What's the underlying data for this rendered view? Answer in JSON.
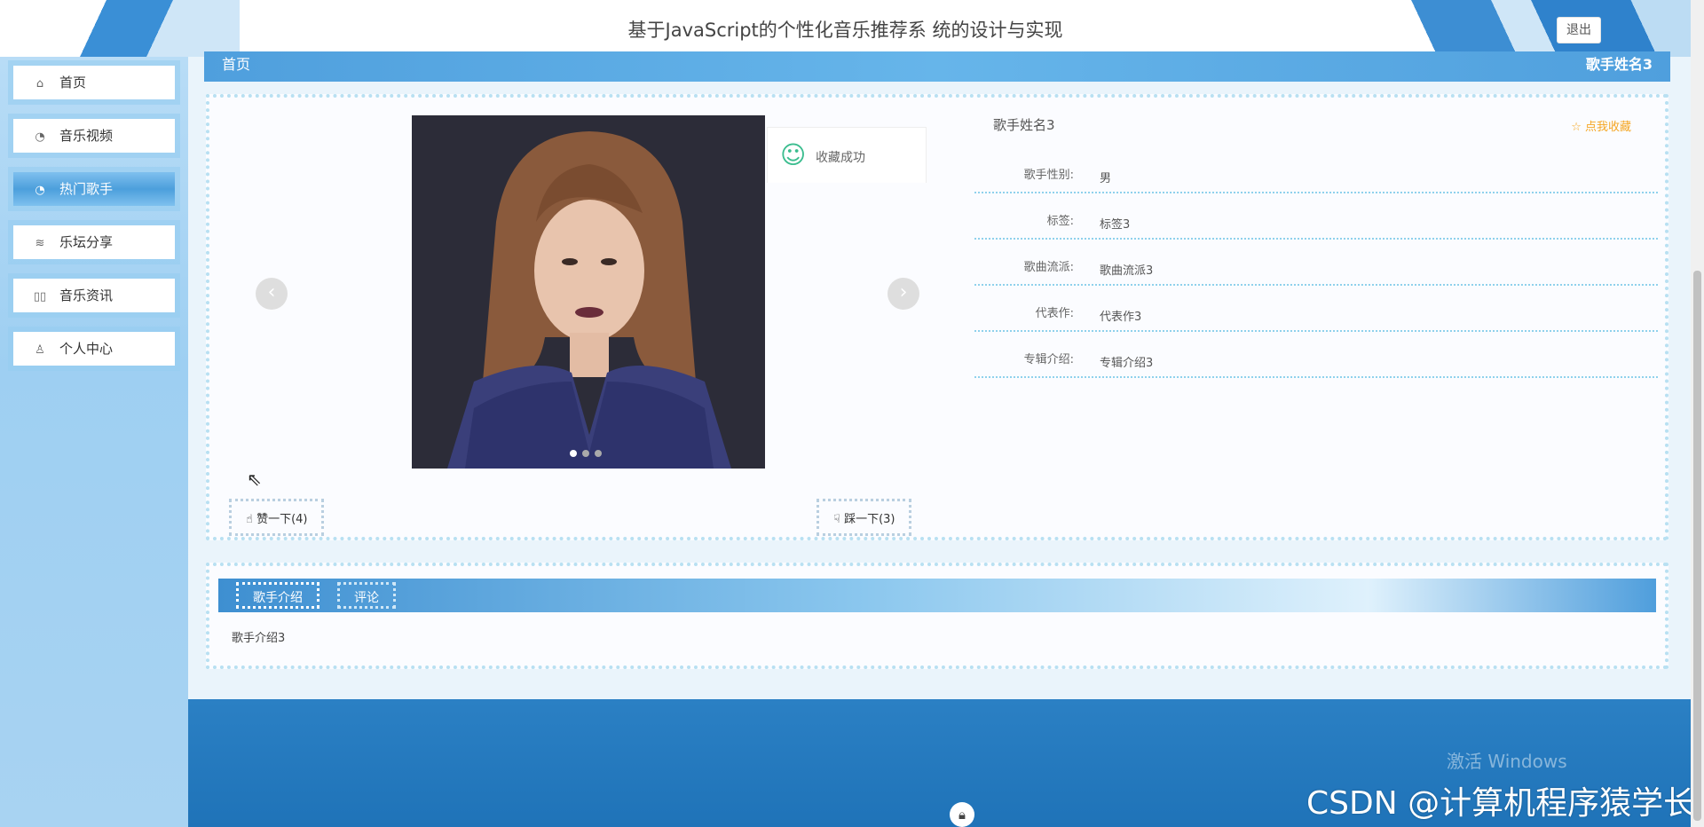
{
  "header": {
    "title": "基于JavaScript的个性化音乐推荐系 统的设计与实现",
    "logout_label": "退出"
  },
  "sidebar": {
    "items": [
      {
        "label": "首页",
        "icon": "home-icon",
        "active": false
      },
      {
        "label": "音乐视频",
        "icon": "palette-icon",
        "active": false
      },
      {
        "label": "热门歌手",
        "icon": "palette-icon",
        "active": true
      },
      {
        "label": "乐坛分享",
        "icon": "layers-icon",
        "active": false
      },
      {
        "label": "音乐资讯",
        "icon": "pause-icon",
        "active": false
      },
      {
        "label": "个人中心",
        "icon": "user-icon",
        "active": false
      }
    ]
  },
  "breadcrumb": {
    "left": "首页",
    "right": "歌手姓名3"
  },
  "toast": {
    "text": "收藏成功"
  },
  "votes": {
    "like": "赞一下(4)",
    "dislike": "踩一下(3)"
  },
  "detail": {
    "name": "歌手姓名3",
    "favorite_label": "点我收藏",
    "rows": [
      {
        "key": "歌手性别:",
        "value": "男"
      },
      {
        "key": "标签:",
        "value": "标签3"
      },
      {
        "key": "歌曲流派:",
        "value": "歌曲流派3"
      },
      {
        "key": "代表作:",
        "value": "代表作3"
      },
      {
        "key": "专辑介绍:",
        "value": "专辑介绍3"
      }
    ]
  },
  "tabs": {
    "items": [
      {
        "label": "歌手介绍"
      },
      {
        "label": "评论"
      }
    ],
    "content": "歌手介绍3"
  },
  "watermarks": {
    "windows": "激活 Windows",
    "csdn": "CSDN @计算机程序猿学长"
  },
  "colors": {
    "accent": "#4f9fdd",
    "favorite": "#f5a623",
    "footer": "#2b80c4"
  }
}
